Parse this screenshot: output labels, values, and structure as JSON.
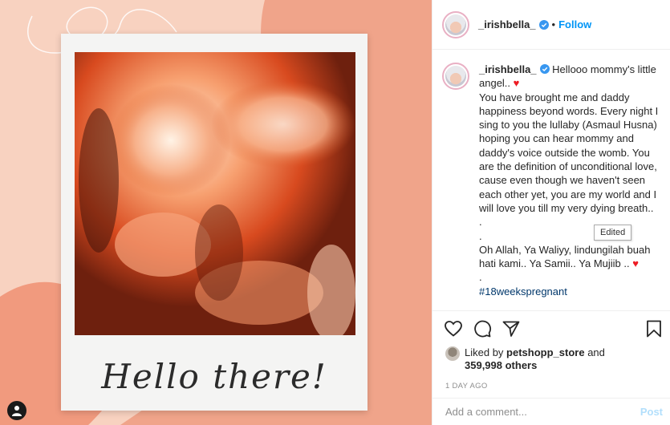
{
  "media": {
    "caption_script": "Hello there!"
  },
  "header": {
    "username": "_irishbella_",
    "separator": "•",
    "follow_label": "Follow"
  },
  "post": {
    "username": "_irishbella_",
    "lines": {
      "l1": "Hellooo mommy's little angel..",
      "l2": "You have brought me and daddy happiness beyond words. Every night I sing to you the lullaby (Asmaul Husna) hoping you can hear mommy and daddy's voice outside the womb. You are the definition of unconditional love, cause even though we haven't seen each other yet, you are my world and I will love you till my very dying breath..",
      "dot1": ".",
      "dot2": ".",
      "l3": "Oh Allah, Ya Waliyy, lindungilah buah hati kami.. Ya Samii.. Ya Mujiib ..",
      "dot3": ".",
      "hashtag": "#18weekspregnant"
    },
    "heart": "♥",
    "tooltip": "Edited"
  },
  "likes": {
    "prefix": "Liked by",
    "liker": "petshopp_store",
    "joiner": "and",
    "others": "359,998 others"
  },
  "date": "1 DAY AGO",
  "comment_box": {
    "placeholder": "Add a comment...",
    "post_label": "Post"
  },
  "colors": {
    "accent_link": "#0095f6",
    "verified": "#3897f0",
    "heart": "#ed1c24",
    "hashtag": "#00376b",
    "background_peach": "#f7c9b4",
    "background_coral": "#f09a80"
  },
  "icons": {
    "verified": "verified-badge-icon",
    "like": "heart-outline-icon",
    "comment": "speech-bubble-icon",
    "share": "paper-plane-icon",
    "save": "bookmark-icon",
    "user_tag": "user-tag-icon"
  }
}
